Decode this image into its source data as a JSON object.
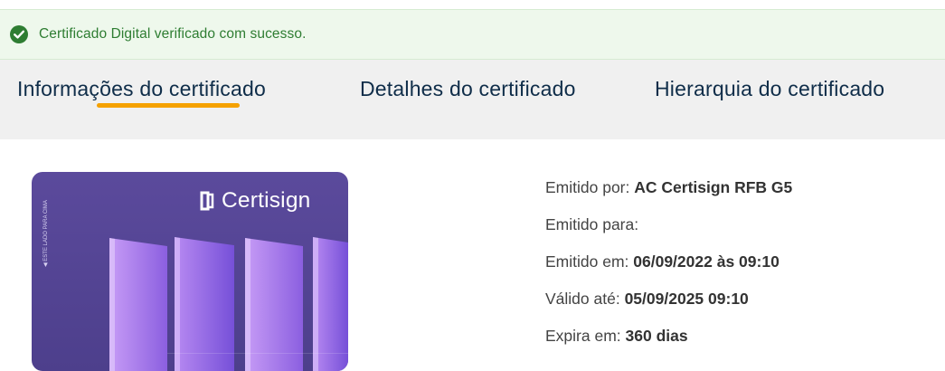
{
  "alert": {
    "icon": "check-circle-icon",
    "message": "Certificado Digital verificado com sucesso."
  },
  "tabs": [
    {
      "label": "Informações do certificado",
      "active": true
    },
    {
      "label": "Detalhes do certificado",
      "active": false
    },
    {
      "label": "Hierarquia do certificado",
      "active": false
    }
  ],
  "card": {
    "brand": "Certisign",
    "side_text": "◀ ESTE LADO PARA CIMA"
  },
  "info": {
    "issued_by_label": "Emitido por:",
    "issued_by_value": "AC Certisign RFB G5",
    "issued_to_label": "Emitido para:",
    "issued_to_value": "",
    "issued_on_label": "Emitido em:",
    "issued_on_value": "06/09/2022 às 09:10",
    "valid_until_label": "Válido até:",
    "valid_until_value": "05/09/2025 09:10",
    "expires_in_label": "Expira em:",
    "expires_in_value": "360 dias"
  },
  "colors": {
    "alert_bg": "#eef8ec",
    "alert_text": "#2e7d32",
    "tab_text": "#0f2d49",
    "tab_active_underline": "#f5a100",
    "card_bg": "#4d3f8c"
  }
}
